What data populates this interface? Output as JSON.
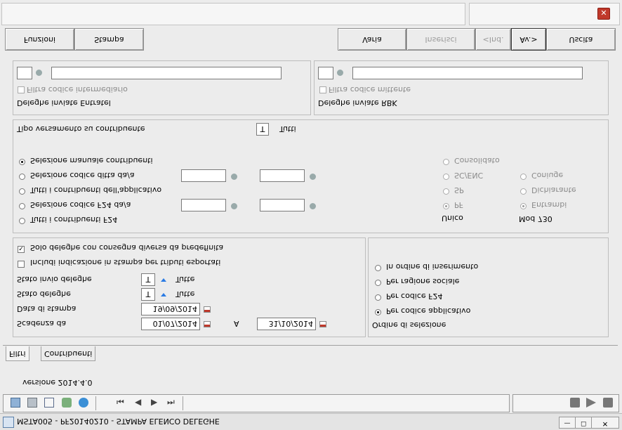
{
  "window": {
    "title": "MSTA005 - PF20140210 - STAMPA ELENCO DELEGHE",
    "close_glyph": "✕",
    "min_glyph": "—",
    "max_glyph": "☐"
  },
  "toolbar": {
    "funzioni": "Funzioni",
    "stampa": "Stampa",
    "varia": "Varia",
    "inserisci": "Inserisci",
    "ind": "<Ind.",
    "av": "Av.>",
    "uscita": "Uscita"
  },
  "deleghe_entratel": {
    "group_label": "Deleghe inviate Entratel",
    "filter_label": "Filtra codice intermediario"
  },
  "deleghe_rbk": {
    "group_label": "Deleghe inviate RBK",
    "filter_label": "Filtra codice mittente"
  },
  "contribuenti": {
    "tipo_label": "Tipo versamento su contribuente",
    "tipo_value": "T",
    "tipo_desc": "Tutti",
    "options": [
      "Selezione manuale contribuenti",
      "Selezione codice ditta da/a",
      "Tutti i contribuenti dell'applicativo",
      "Selezione codice F24 da/a",
      "Tutti i contribuenti F24"
    ],
    "unico_label": "Unico",
    "unico_options": [
      "PF",
      "SP",
      "SC/ENC",
      "Consolidato"
    ],
    "mod730_label": "Mod 730",
    "mod730_options": [
      "Entrambi",
      "Dichiarante",
      "Coniuge"
    ]
  },
  "stampa": {
    "solo_deleghe": "Solo deleghe con consegna diversa da predefinita",
    "includi": "Includi indicazione in stampa per tributi esportati",
    "stato_invio_label": "Stato invio deleghe",
    "stato_invio_value": "T",
    "stato_invio_desc": "Tutte",
    "stato_deleghe_label": "Stato deleghe",
    "stato_deleghe_value": "T",
    "stato_deleghe_desc": "Tutte",
    "data_stampa_label": "Data di stampa",
    "data_stampa_value": "19/09/2014",
    "scadenza_label": "Scadenza da",
    "scadenza_da": "01/07/2014",
    "a_label": "A",
    "scadenza_a": "31/10/2014"
  },
  "ordine": {
    "label": "Ordine di selezione",
    "options": [
      "In ordine di inserimento",
      "Per ragione sociale",
      "Per codice F24",
      "Per codice applicativo"
    ]
  },
  "tabs": [
    "Filtri",
    "Contribuenti"
  ],
  "version": "versione 2014.4.0",
  "nav": {
    "first": "⏮",
    "prev": "◀",
    "next": "▶",
    "last": "⏭"
  }
}
